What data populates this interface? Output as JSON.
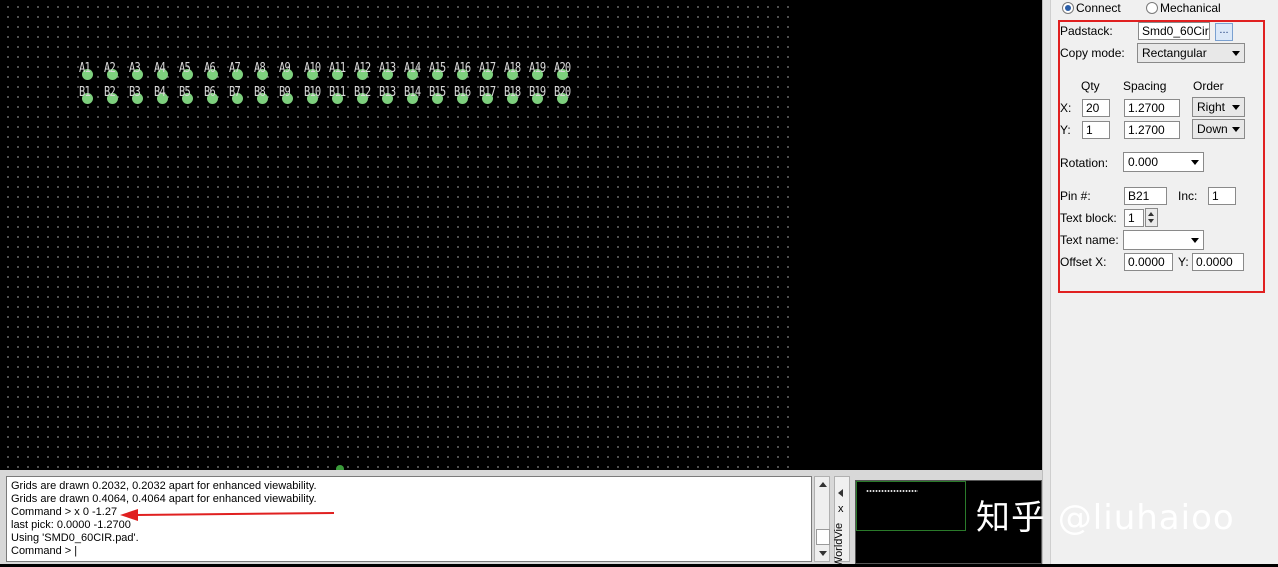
{
  "pads": {
    "row_a_labels": [
      "A1",
      "A2",
      "A3",
      "A4",
      "A5",
      "A6",
      "A7",
      "A8",
      "A9",
      "A10",
      "A11",
      "A12",
      "A13",
      "A14",
      "A15",
      "A16",
      "A17",
      "A18",
      "A19",
      "A20"
    ],
    "row_b_labels": [
      "B1",
      "B2",
      "B3",
      "B4",
      "B5",
      "B6",
      "B7",
      "B8",
      "B9",
      "B10",
      "B11",
      "B12",
      "B13",
      "B14",
      "B15",
      "B16",
      "B17",
      "B18",
      "B19",
      "B20"
    ],
    "pad_color": "#7ed07e"
  },
  "mode": {
    "connect_label": "Connect",
    "mechanical_label": "Mechanical",
    "selected": "Connect"
  },
  "form": {
    "padstack_label": "Padstack:",
    "padstack_value": "Smd0_60Cir",
    "browse_label": "...",
    "copy_mode_label": "Copy mode:",
    "copy_mode_value": "Rectangular",
    "qty_header": "Qty",
    "spacing_header": "Spacing",
    "order_header": "Order",
    "x_label": "X:",
    "x_qty": "20",
    "x_spacing": "1.2700",
    "x_order": "Right",
    "y_label": "Y:",
    "y_qty": "1",
    "y_spacing": "1.2700",
    "y_order": "Down",
    "rotation_label": "Rotation:",
    "rotation_value": "0.000",
    "pin_label": "Pin #:",
    "pin_value": "B21",
    "inc_label": "Inc:",
    "inc_value": "1",
    "text_block_label": "Text block:",
    "text_block_value": "1",
    "text_name_label": "Text name:",
    "text_name_value": "",
    "offset_x_label": "Offset X:",
    "offset_x_value": "0.0000",
    "offset_y_label": "Y:",
    "offset_y_value": "0.0000"
  },
  "command": {
    "lines": [
      "Grids are drawn 0.2032, 0.2032 apart for enhanced viewability.",
      "Grids are drawn 0.4064, 0.4064 apart for enhanced viewability.",
      "Command > x 0 -1.27",
      "last pick:  0.0000 -1.2700",
      "Using 'SMD0_60CIR.pad'.",
      "Command > |"
    ]
  },
  "worldview": {
    "tab_label": "WorldVie",
    "close_label": "x"
  },
  "watermark": "知乎 @liuhaioo",
  "colors": {
    "highlight": "#e02020",
    "canvas": "#000000",
    "panel": "#f0f0f0"
  }
}
